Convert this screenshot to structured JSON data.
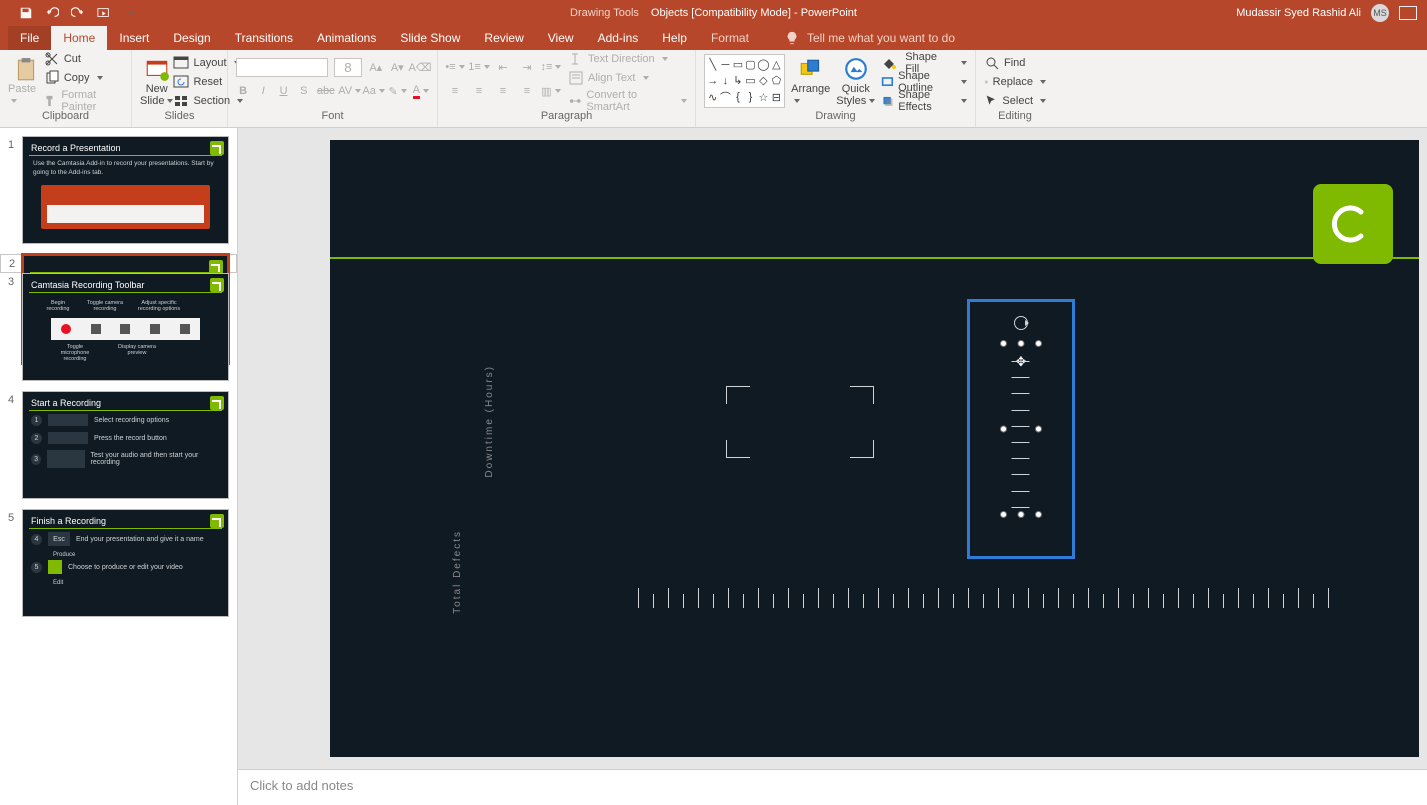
{
  "title": {
    "contextual_tab_group": "Drawing Tools",
    "doc": "Objects [Compatibility Mode]  -  PowerPoint",
    "user": "Mudassir Syed Rashid Ali",
    "avatar_initials": "MS"
  },
  "qat": {
    "save": "Save",
    "undo": "Undo",
    "redo": "Redo",
    "start_from_beginning": "Start From Beginning"
  },
  "tabs": {
    "file": "File",
    "home": "Home",
    "insert": "Insert",
    "design": "Design",
    "transitions": "Transitions",
    "animations": "Animations",
    "slideshow": "Slide Show",
    "review": "Review",
    "view": "View",
    "addins": "Add-ins",
    "help": "Help",
    "format": "Format",
    "tellme_placeholder": "Tell me what you want to do"
  },
  "ribbon": {
    "clipboard": {
      "paste": "Paste",
      "cut": "Cut",
      "copy": "Copy",
      "format_painter": "Format Painter",
      "label": "Clipboard"
    },
    "slides": {
      "new_slide": "New\nSlide",
      "layout": "Layout",
      "reset": "Reset",
      "section": "Section",
      "label": "Slides"
    },
    "font": {
      "name_value": "",
      "size_value": "8",
      "label": "Font"
    },
    "paragraph": {
      "text_direction": "Text Direction",
      "align_text": "Align Text",
      "convert_smartart": "Convert to SmartArt",
      "label": "Paragraph"
    },
    "drawing": {
      "arrange": "Arrange",
      "quick_styles": "Quick\nStyles",
      "shape_fill": "Shape Fill",
      "shape_outline": "Shape Outline",
      "shape_effects": "Shape Effects",
      "label": "Drawing"
    },
    "editing": {
      "find": "Find",
      "replace": "Replace",
      "select": "Select",
      "label": "Editing"
    }
  },
  "thumbs": [
    {
      "n": "1",
      "title": "Record a Presentation",
      "body": "Use the Camtasia Add-in to record your presentations. Start by going to the Add-ins tab."
    },
    {
      "n": "2",
      "title": ""
    },
    {
      "n": "3",
      "title": "Camtasia Recording Toolbar",
      "labels": [
        "Begin recording",
        "Toggle camera recording",
        "Adjust specific recording options",
        "Toggle microphone recording",
        "Display camera preview"
      ]
    },
    {
      "n": "4",
      "title": "Start a Recording",
      "steps": [
        "Select recording options",
        "Press the record button",
        "Test your audio and then start your recording"
      ]
    },
    {
      "n": "5",
      "title": "Finish a Recording",
      "steps": [
        "End your presentation and give it a name",
        "Choose to produce or edit your video"
      ],
      "sub": [
        "Esc",
        "Produce",
        "Edit"
      ]
    }
  ],
  "slide": {
    "axis_y1": "Downtime (Hours)",
    "axis_y2": "Total Defects"
  },
  "notes_placeholder": "Click to add notes"
}
